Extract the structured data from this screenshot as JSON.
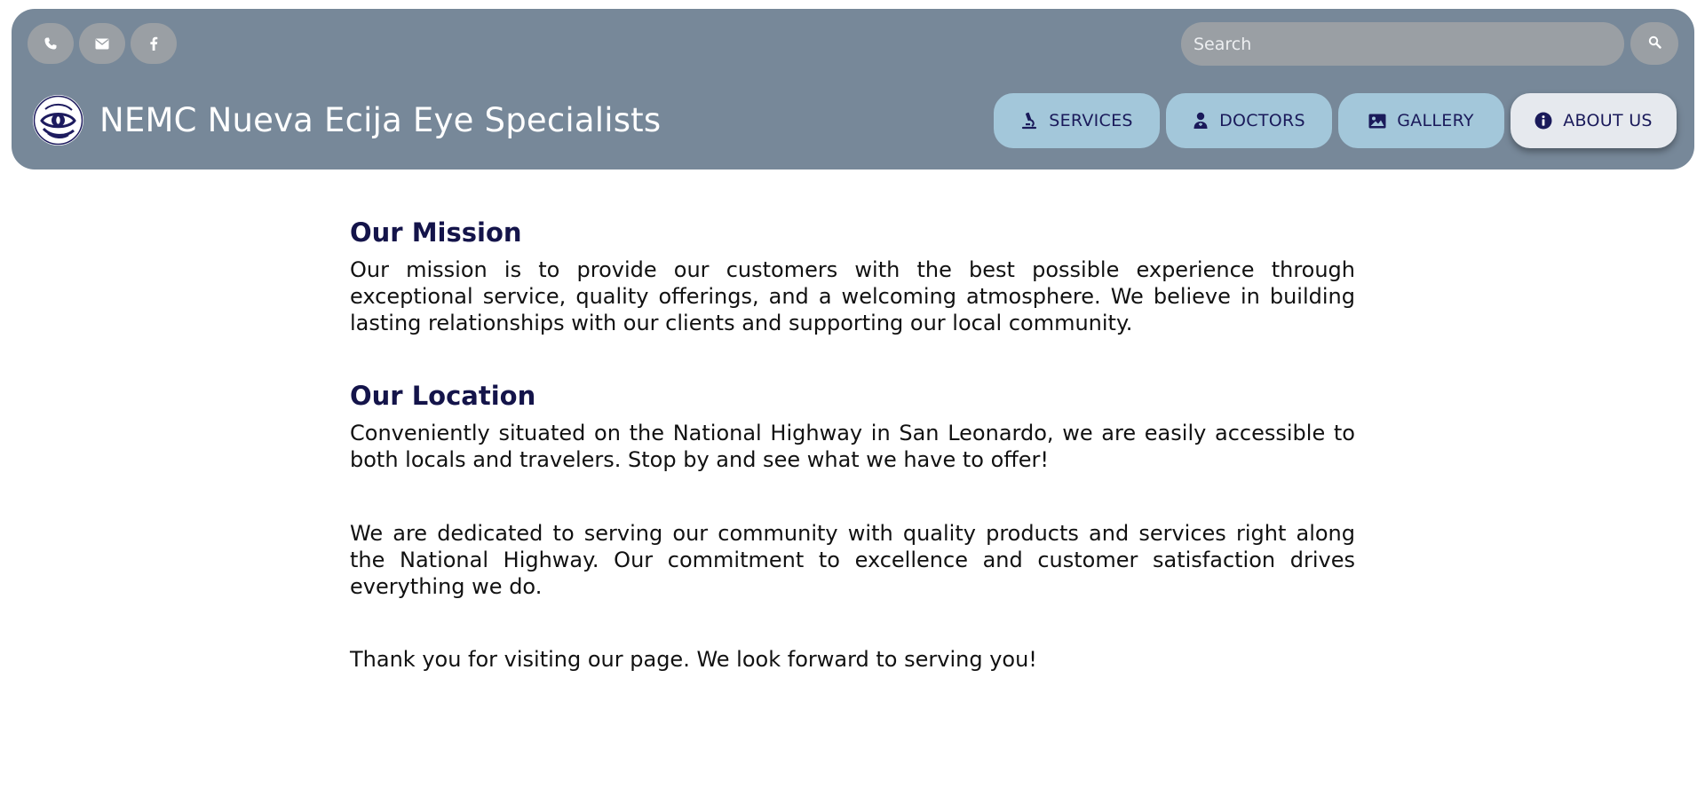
{
  "header": {
    "brand_title": "NEMC Nueva Ecija Eye Specialists",
    "background_color": "#778899",
    "social_icons": [
      "phone-icon",
      "envelope-icon",
      "facebook-icon"
    ],
    "search": {
      "placeholder": "Search",
      "value": "",
      "button_icon": "search-icon"
    },
    "nav": [
      {
        "label": "SERVICES",
        "icon": "microscope-icon",
        "active": false
      },
      {
        "label": "DOCTORS",
        "icon": "doctor-icon",
        "active": false
      },
      {
        "label": "GALLERY",
        "icon": "image-icon",
        "active": false
      },
      {
        "label": "ABOUT US",
        "icon": "info-icon",
        "active": true
      }
    ],
    "nav_color": "#a3c7da",
    "nav_active_color": "#e6e9ee"
  },
  "main": {
    "mission_title": "Our Mission",
    "mission_text": "Our mission is to provide our customers with the best possible experience through exceptional service, quality offerings, and a welcoming atmosphere. We believe in building lasting relationships with our clients and supporting our local community.",
    "location_title": "Our Location",
    "location_text": "Conveniently situated on the National Highway in San Leonardo, we are easily accessible to both locals and travelers. Stop by and see what we have to offer!",
    "dedicated_text": "We are dedicated to serving our community with quality products and services right along the National Highway. Our commitment to excellence and customer satisfaction drives everything we do.",
    "thanks_text": "Thank you for visiting our page. We look forward to serving you!",
    "heading_color": "#14144a"
  }
}
